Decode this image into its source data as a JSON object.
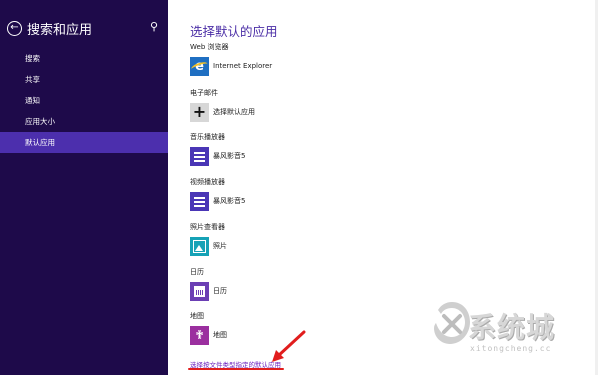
{
  "sidebar": {
    "title": "搜索和应用",
    "items": [
      {
        "label": "搜索"
      },
      {
        "label": "共享"
      },
      {
        "label": "通知"
      },
      {
        "label": "应用大小"
      },
      {
        "label": "默认应用"
      }
    ],
    "active_index": 4
  },
  "main": {
    "title": "选择默认的应用",
    "sections": [
      {
        "label": "Web 浏览器",
        "app": "Internet Explorer",
        "icon": "internet-explorer-icon"
      },
      {
        "label": "电子邮件",
        "app": "选择默认应用",
        "icon": "plus-icon"
      },
      {
        "label": "音乐播放器",
        "app": "暴风影音5",
        "icon": "player-icon"
      },
      {
        "label": "视频播放器",
        "app": "暴风影音5",
        "icon": "player-icon"
      },
      {
        "label": "照片查看器",
        "app": "照片",
        "icon": "photos-icon"
      },
      {
        "label": "日历",
        "app": "日历",
        "icon": "calendar-icon"
      },
      {
        "label": "地图",
        "app": "地图",
        "icon": "maps-icon"
      }
    ],
    "link_text": "选择按文件类型指定的默认应用"
  },
  "watermark": {
    "text": "系统城",
    "subtext": "xitongcheng.cc"
  },
  "colors": {
    "sidebar_bg": "#1e0a4a",
    "sidebar_active": "#4c2fad",
    "accent": "#4b2ea6",
    "annotation_red": "#e11d1d"
  }
}
